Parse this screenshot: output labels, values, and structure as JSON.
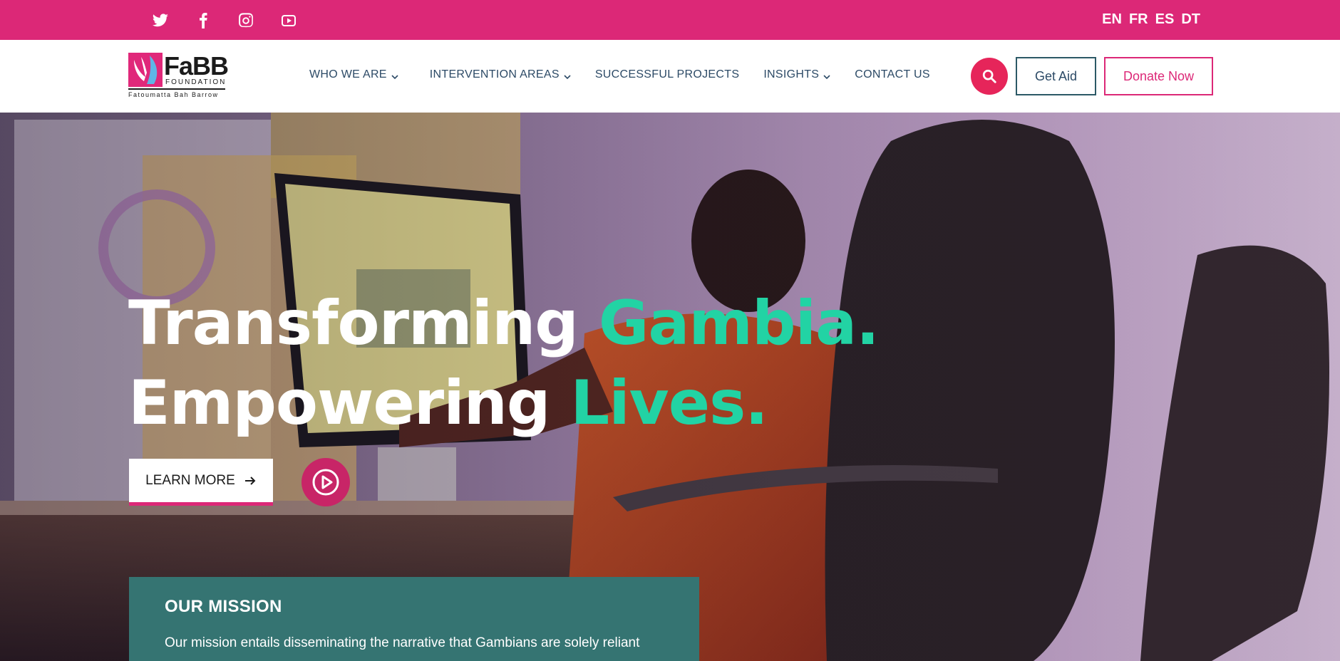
{
  "social": {
    "items": [
      {
        "icon": "twitter-icon"
      },
      {
        "icon": "facebook-icon"
      },
      {
        "icon": "instagram-icon"
      },
      {
        "icon": "youtube-icon"
      }
    ]
  },
  "languages": [
    "EN",
    "FR",
    "ES",
    "DT"
  ],
  "logo": {
    "name": "FaBB",
    "sub": "FOUNDATION",
    "tagline": "Fatoumatta Bah Barrow"
  },
  "nav": {
    "items": [
      {
        "label": "WHO WE ARE",
        "dropdown": true
      },
      {
        "label": "INTERVENTION AREAS",
        "dropdown": true
      },
      {
        "label": "SUCCESSFUL PROJECTS",
        "dropdown": false
      },
      {
        "label": "INSIGHTS",
        "dropdown": true
      },
      {
        "label": "CONTACT US",
        "dropdown": false
      }
    ],
    "get_aid": "Get Aid",
    "donate": "Donate Now"
  },
  "hero": {
    "line1_white": "Transforming ",
    "line1_accent": "Gambia.",
    "line2_white": "Empowering ",
    "line2_accent": "Lives.",
    "learn_more": "LEARN MORE"
  },
  "mission": {
    "title": "OUR MISSION",
    "text": "Our mission entails disseminating the narrative that Gambians are solely reliant"
  },
  "colors": {
    "brand_pink": "#dc2877",
    "accent_green": "#22d3a4",
    "mission_teal": "#357472",
    "nav_text": "#2c4a66",
    "search_red": "#e6255a"
  }
}
